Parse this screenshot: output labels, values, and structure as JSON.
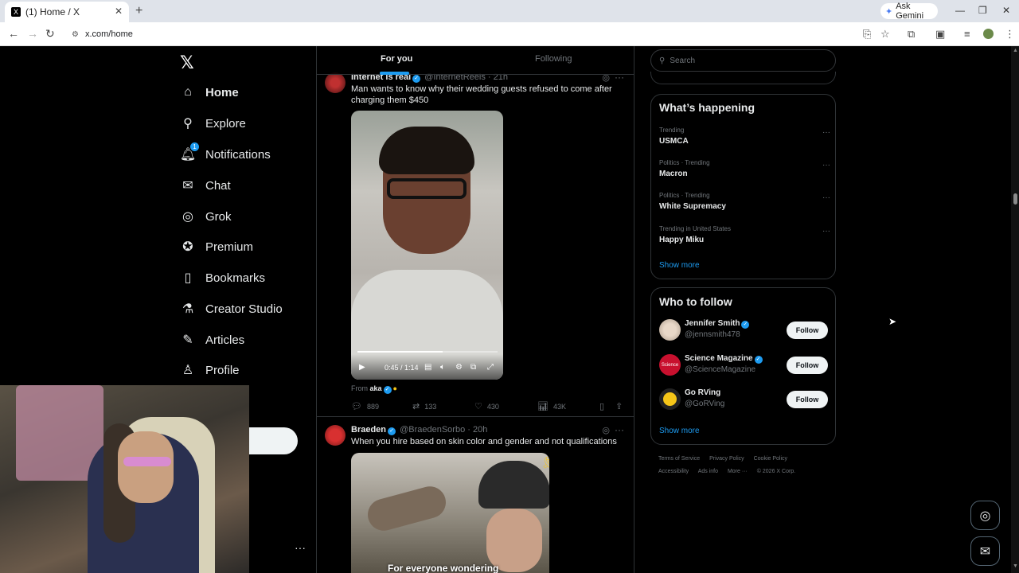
{
  "browser": {
    "tab_title": "(1) Home / X",
    "tab_close": "✕",
    "new_tab": "+",
    "gemini_label": "Ask Gemini",
    "url": "x.com/home"
  },
  "nav": {
    "items": [
      {
        "label": "Home",
        "icon": "home-icon"
      },
      {
        "label": "Explore",
        "icon": "search-icon"
      },
      {
        "label": "Notifications",
        "icon": "bell-icon",
        "badge": "1"
      },
      {
        "label": "Chat",
        "icon": "mail-icon"
      },
      {
        "label": "Grok",
        "icon": "grok-icon"
      },
      {
        "label": "Premium",
        "icon": "premium-icon"
      },
      {
        "label": "Bookmarks",
        "icon": "bookmark-icon"
      },
      {
        "label": "Creator Studio",
        "icon": "flask-icon"
      },
      {
        "label": "Articles",
        "icon": "article-icon"
      },
      {
        "label": "Profile",
        "icon": "person-icon"
      }
    ],
    "account_more": "···"
  },
  "feed": {
    "tabs": [
      "For you",
      "Following"
    ],
    "post1": {
      "name": "Internet is real",
      "handle": "@InternetReels",
      "time": "21h",
      "text": "Man wants to know why their wedding guests refused to come after charging them $450",
      "video_time": "0:45 / 1:14",
      "video_progress": 0.61,
      "from_label": "From",
      "from_name": "aka",
      "replies": "889",
      "reposts": "133",
      "likes": "430",
      "views": "43K"
    },
    "post2": {
      "name": "Braeden",
      "handle": "@BraedenSorbo",
      "time": "20h",
      "text": "When you hire based on skin color and gender and not qualifications",
      "caption": "For everyone wondering"
    }
  },
  "sidebar": {
    "search_placeholder": "Search",
    "whats_happening_title": "What’s happening",
    "trends": [
      {
        "meta": "Trending",
        "topic": "USMCA"
      },
      {
        "meta": "Politics · Trending",
        "topic": "Macron"
      },
      {
        "meta": "Politics · Trending",
        "topic": "White Supremacy"
      },
      {
        "meta": "Trending in United States",
        "topic": "Happy Miku"
      }
    ],
    "show_more": "Show more",
    "who_to_follow_title": "Who to follow",
    "follow_suggestions": [
      {
        "name": "Jennifer Smith",
        "handle": "@jennsmith478",
        "button": "Follow"
      },
      {
        "name": "Science Magazine",
        "handle": "@ScienceMagazine",
        "button": "Follow"
      },
      {
        "name": "Go RVing",
        "handle": "@GoRVing",
        "button": "Follow"
      }
    ],
    "footer": [
      "Terms of Service",
      "Privacy Policy",
      "Cookie Policy",
      "Accessibility",
      "Ads info",
      "More ···",
      "© 2026 X Corp."
    ]
  },
  "colors": {
    "accent": "#1d9bf0",
    "background": "#000000",
    "text": "#e7e9ea",
    "muted": "#71767b"
  }
}
